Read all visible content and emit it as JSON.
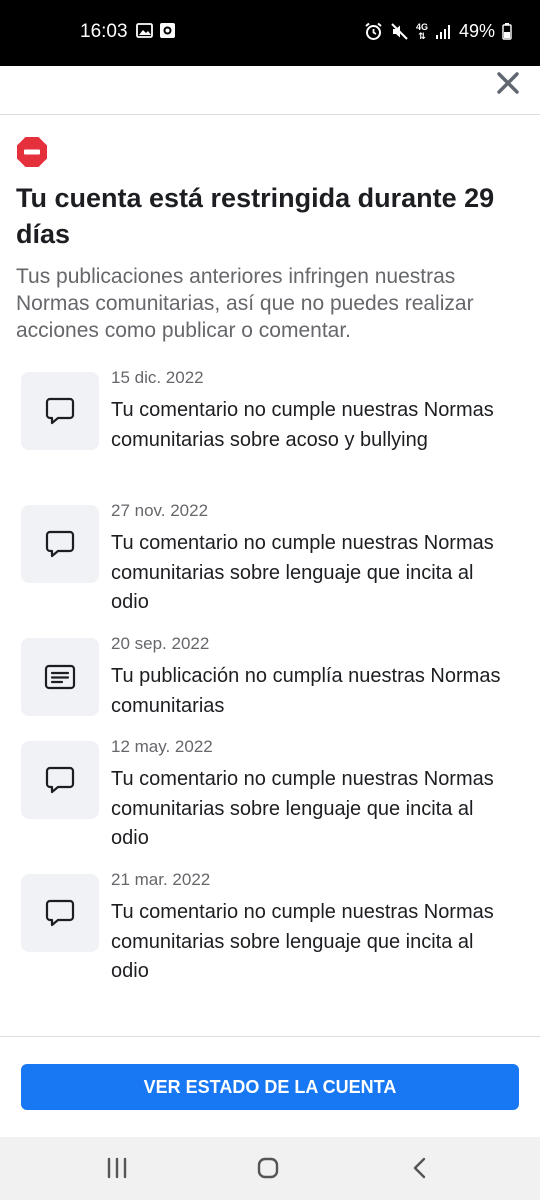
{
  "status_bar": {
    "time": "16:03",
    "network": "4G",
    "battery": "49%"
  },
  "header": {
    "title": "Tu cuenta está restringida durante 29 días",
    "subtitle": "Tus publicaciones anteriores infringen nuestras Normas comunitarias, así que no puedes realizar acciones como publicar o comentar."
  },
  "violations": [
    {
      "icon": "comment-icon",
      "date": "15 dic. 2022",
      "text": "Tu comentario no cumple nuestras Normas comunitarias sobre acoso y bullying"
    },
    {
      "icon": "comment-icon",
      "date": "27 nov. 2022",
      "text": "Tu comentario no cumple nuestras Normas comunitarias sobre lenguaje que incita al odio"
    },
    {
      "icon": "post-icon",
      "date": "20 sep. 2022",
      "text": "Tu publicación no cumplía nuestras Normas comunitarias"
    },
    {
      "icon": "comment-icon",
      "date": "12 may. 2022",
      "text": "Tu comentario no cumple nuestras Normas comunitarias sobre lenguaje que incita al odio"
    },
    {
      "icon": "comment-icon",
      "date": "21 mar. 2022",
      "text": "Tu comentario no cumple nuestras Normas comunitarias sobre lenguaje que incita al odio"
    }
  ],
  "footer": {
    "button_label": "VER ESTADO DE LA CUENTA"
  },
  "colors": {
    "accent": "#1877f2",
    "warning": "#e4313b",
    "text_primary": "#1c1e21",
    "text_secondary": "#65676b"
  }
}
